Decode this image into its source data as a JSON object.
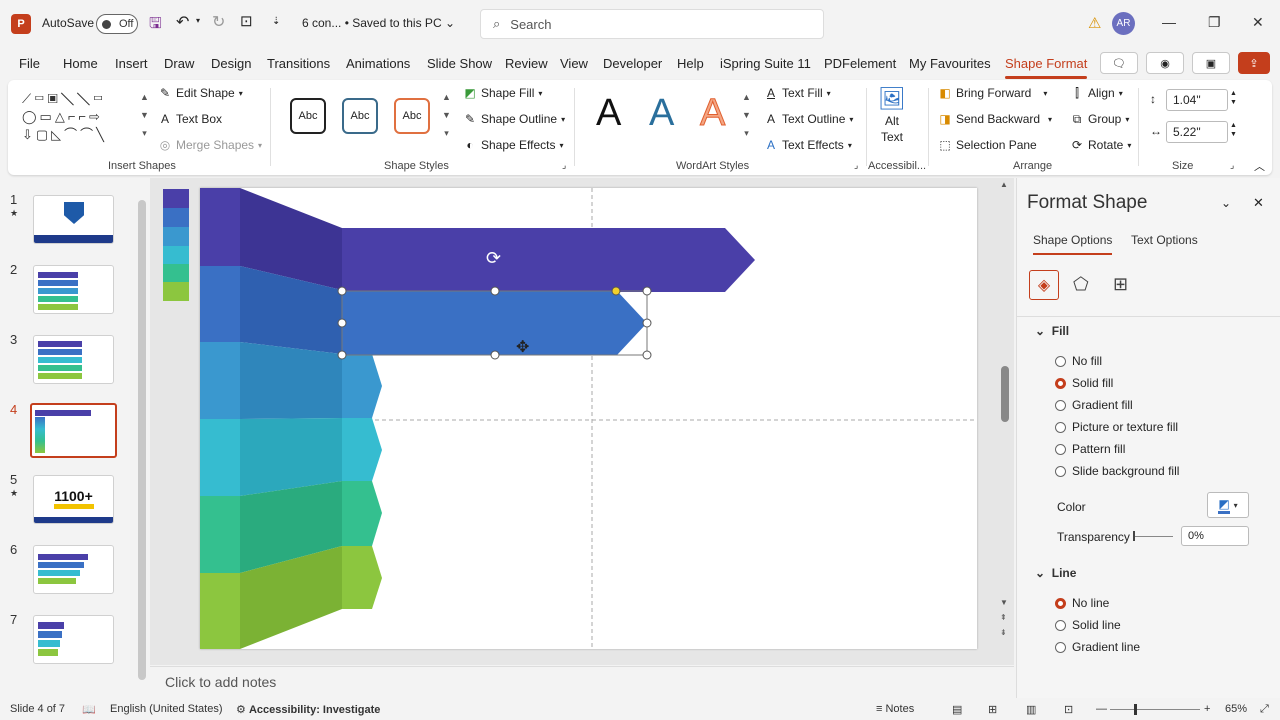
{
  "app": {
    "logo": "P",
    "autosave_label": "AutoSave",
    "autosave_state": "Off",
    "file_title": "6 con... • Saved to this PC",
    "search_placeholder": "Search",
    "user_initials": "AR",
    "brand_color": "#c43e1c"
  },
  "menu": [
    "File",
    "Home",
    "Insert",
    "Draw",
    "Design",
    "Transitions",
    "Animations",
    "Slide Show",
    "Review",
    "View",
    "Developer",
    "Help",
    "iSpring Suite 11",
    "PDFelement",
    "My Favourites",
    "Shape Format"
  ],
  "ribbon": {
    "insert_shapes": {
      "label": "Insert Shapes",
      "edit_shape": "Edit Shape",
      "text_box": "Text Box",
      "merge_shapes": "Merge Shapes"
    },
    "shape_styles": {
      "label": "Shape Styles",
      "abc": "Abc",
      "shape_fill": "Shape Fill",
      "shape_outline": "Shape Outline",
      "shape_effects": "Shape Effects"
    },
    "wordart": {
      "label": "WordArt Styles",
      "letter": "A",
      "text_fill": "Text Fill",
      "text_outline": "Text Outline",
      "text_effects": "Text Effects"
    },
    "accessibility": {
      "label": "Accessibil...",
      "alt_text_line1": "Alt",
      "alt_text_line2": "Text"
    },
    "arrange": {
      "label": "Arrange",
      "bring_forward": "Bring Forward",
      "send_backward": "Send Backward",
      "selection_pane": "Selection Pane",
      "align": "Align",
      "group": "Group",
      "rotate": "Rotate"
    },
    "size": {
      "label": "Size",
      "height": "1.04\"",
      "width": "5.22\""
    }
  },
  "slides": [
    {
      "num": "1",
      "star": "★"
    },
    {
      "num": "2",
      "star": ""
    },
    {
      "num": "3",
      "star": ""
    },
    {
      "num": "4",
      "star": ""
    },
    {
      "num": "5",
      "star": "★",
      "thumb_text": "1100+"
    },
    {
      "num": "6",
      "star": ""
    },
    {
      "num": "7",
      "star": ""
    }
  ],
  "colors": {
    "c1": "#4a3fa8",
    "c2": "#3a70c4",
    "c3": "#3a98cf",
    "c4": "#36bcd0",
    "c5": "#34c08f",
    "c6": "#8cc63f"
  },
  "notes_placeholder": "Click to add notes",
  "format_pane": {
    "title": "Format Shape",
    "tab_shape": "Shape Options",
    "tab_text": "Text Options",
    "fill_section": "Fill",
    "fill_options": [
      "No fill",
      "Solid fill",
      "Gradient fill",
      "Picture or texture fill",
      "Pattern fill",
      "Slide background fill"
    ],
    "fill_selected": 1,
    "color_label": "Color",
    "transparency_label": "Transparency",
    "transparency_value": "0%",
    "line_section": "Line",
    "line_options": [
      "No line",
      "Solid line",
      "Gradient line"
    ],
    "line_selected": 0
  },
  "status": {
    "slide": "Slide 4 of 7",
    "language": "English (United States)",
    "accessibility": "Accessibility: Investigate",
    "notes": "Notes",
    "zoom": "65%"
  }
}
